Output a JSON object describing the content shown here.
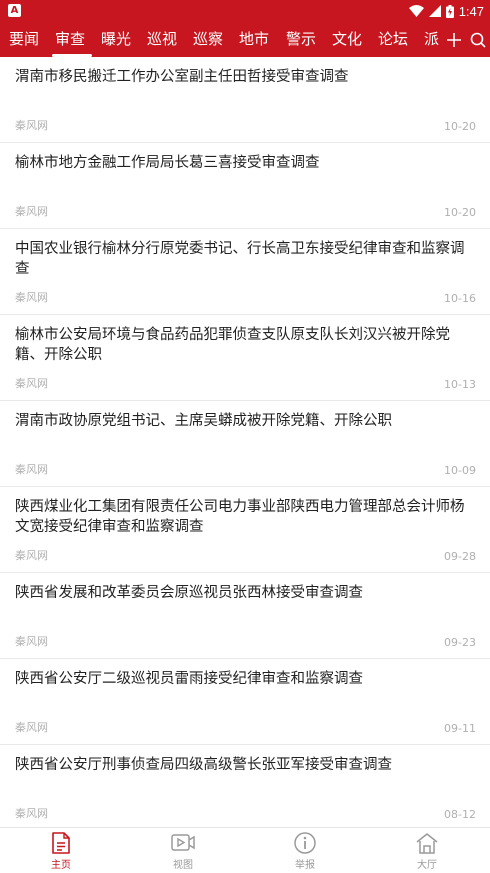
{
  "status_bar": {
    "time": "1:47",
    "left_icon": "A",
    "icons": [
      "wifi-icon",
      "signal-icon",
      "battery-icon"
    ]
  },
  "nav": {
    "tabs": [
      {
        "label": "要闻",
        "active": false
      },
      {
        "label": "审查",
        "active": true
      },
      {
        "label": "曝光",
        "active": false
      },
      {
        "label": "巡视",
        "active": false
      },
      {
        "label": "巡察",
        "active": false
      },
      {
        "label": "地市",
        "active": false
      },
      {
        "label": "警示",
        "active": false
      },
      {
        "label": "文化",
        "active": false
      },
      {
        "label": "论坛",
        "active": false
      },
      {
        "label": "派",
        "active": false
      }
    ],
    "icons": [
      "plus-icon",
      "search-icon"
    ]
  },
  "articles": [
    {
      "title": "渭南市移民搬迁工作办公室副主任田哲接受审查调查",
      "source": "秦风网",
      "date": "10-20"
    },
    {
      "title": "榆林市地方金融工作局局长葛三喜接受审查调查",
      "source": "秦风网",
      "date": "10-20"
    },
    {
      "title": "中国农业银行榆林分行原党委书记、行长高卫东接受纪律审查和监察调查",
      "source": "秦风网",
      "date": "10-16"
    },
    {
      "title": "榆林市公安局环境与食品药品犯罪侦查支队原支队长刘汉兴被开除党籍、开除公职",
      "source": "秦风网",
      "date": "10-13"
    },
    {
      "title": "渭南市政协原党组书记、主席吴蟒成被开除党籍、开除公职",
      "source": "秦风网",
      "date": "10-09"
    },
    {
      "title": "陕西煤业化工集团有限责任公司电力事业部陕西电力管理部总会计师杨文宽接受纪律审查和监察调查",
      "source": "秦风网",
      "date": "09-28"
    },
    {
      "title": "陕西省发展和改革委员会原巡视员张西林接受审查调查",
      "source": "秦风网",
      "date": "09-23"
    },
    {
      "title": "陕西省公安厅二级巡视员雷雨接受纪律审查和监察调查",
      "source": "秦风网",
      "date": "09-11"
    },
    {
      "title": "陕西省公安厅刑事侦查局四级高级警长张亚军接受审查调查",
      "source": "秦风网",
      "date": "08-12"
    }
  ],
  "bottom_nav": [
    {
      "label": "主页",
      "icon": "document-icon",
      "active": true
    },
    {
      "label": "视图",
      "icon": "video-icon",
      "active": false
    },
    {
      "label": "举报",
      "icon": "info-icon",
      "active": false
    },
    {
      "label": "大厅",
      "icon": "house-icon",
      "active": false
    }
  ],
  "colors": {
    "brand": "#c7161f",
    "text": "#222222",
    "meta": "#b0b0b0",
    "inactive": "#9a9a9a"
  }
}
